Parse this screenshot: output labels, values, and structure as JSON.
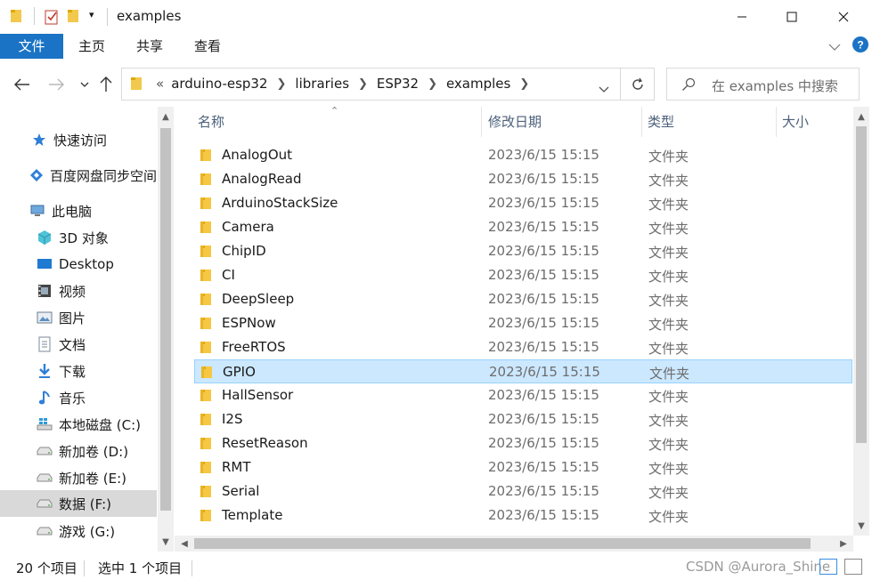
{
  "window": {
    "title": "examples",
    "minimize_icon": "minimize-icon",
    "maximize_icon": "maximize-icon",
    "close_icon": "close-icon"
  },
  "ribbon": {
    "tabs": [
      {
        "label": "文件",
        "active": true
      },
      {
        "label": "主页",
        "active": false
      },
      {
        "label": "共享",
        "active": false
      },
      {
        "label": "查看",
        "active": false
      }
    ],
    "accent": "#1a73c4"
  },
  "address": {
    "overflow": "«",
    "crumbs": [
      "arduino-esp32",
      "libraries",
      "ESP32",
      "examples"
    ]
  },
  "search": {
    "placeholder": "在 examples 中搜索"
  },
  "sidebar": {
    "items": [
      {
        "label": "快速访问",
        "icon": "star-icon",
        "level": 0
      },
      {
        "label": "百度网盘同步空间",
        "icon": "baidu-cloud-icon",
        "level": 0
      },
      {
        "label": "此电脑",
        "icon": "computer-icon",
        "level": 0
      },
      {
        "label": "3D 对象",
        "icon": "cube-3d-icon",
        "level": 1
      },
      {
        "label": "Desktop",
        "icon": "desktop-icon",
        "level": 1
      },
      {
        "label": "视频",
        "icon": "video-icon",
        "level": 1
      },
      {
        "label": "图片",
        "icon": "picture-icon",
        "level": 1
      },
      {
        "label": "文档",
        "icon": "document-icon",
        "level": 1
      },
      {
        "label": "下载",
        "icon": "download-icon",
        "level": 1
      },
      {
        "label": "音乐",
        "icon": "music-icon",
        "level": 1
      },
      {
        "label": "本地磁盘 (C:)",
        "icon": "windows-drive-icon",
        "level": 1
      },
      {
        "label": "新加卷 (D:)",
        "icon": "drive-icon",
        "level": 1
      },
      {
        "label": "新加卷 (E:)",
        "icon": "drive-icon",
        "level": 1
      },
      {
        "label": "数据 (F:)",
        "icon": "drive-icon",
        "level": 1,
        "selected": true
      },
      {
        "label": "游戏 (G:)",
        "icon": "drive-icon",
        "level": 1
      }
    ]
  },
  "list": {
    "columns": {
      "name": "名称",
      "date": "修改日期",
      "type": "类型",
      "size": "大小"
    },
    "rows": [
      {
        "name": "AnalogOut",
        "date": "2023/6/15 15:15",
        "type": "文件夹"
      },
      {
        "name": "AnalogRead",
        "date": "2023/6/15 15:15",
        "type": "文件夹"
      },
      {
        "name": "ArduinoStackSize",
        "date": "2023/6/15 15:15",
        "type": "文件夹"
      },
      {
        "name": "Camera",
        "date": "2023/6/15 15:15",
        "type": "文件夹"
      },
      {
        "name": "ChipID",
        "date": "2023/6/15 15:15",
        "type": "文件夹"
      },
      {
        "name": "CI",
        "date": "2023/6/15 15:15",
        "type": "文件夹"
      },
      {
        "name": "DeepSleep",
        "date": "2023/6/15 15:15",
        "type": "文件夹"
      },
      {
        "name": "ESPNow",
        "date": "2023/6/15 15:15",
        "type": "文件夹"
      },
      {
        "name": "FreeRTOS",
        "date": "2023/6/15 15:15",
        "type": "文件夹"
      },
      {
        "name": "GPIO",
        "date": "2023/6/15 15:15",
        "type": "文件夹",
        "selected": true
      },
      {
        "name": "HallSensor",
        "date": "2023/6/15 15:15",
        "type": "文件夹"
      },
      {
        "name": "I2S",
        "date": "2023/6/15 15:15",
        "type": "文件夹"
      },
      {
        "name": "ResetReason",
        "date": "2023/6/15 15:15",
        "type": "文件夹"
      },
      {
        "name": "RMT",
        "date": "2023/6/15 15:15",
        "type": "文件夹"
      },
      {
        "name": "Serial",
        "date": "2023/6/15 15:15",
        "type": "文件夹"
      },
      {
        "name": "Template",
        "date": "2023/6/15 15:15",
        "type": "文件夹"
      }
    ],
    "selection_color": "#cce8ff"
  },
  "status": {
    "count": "20 个项目",
    "selected": "选中 1 个项目",
    "watermark": "CSDN @Aurora_Shine"
  }
}
